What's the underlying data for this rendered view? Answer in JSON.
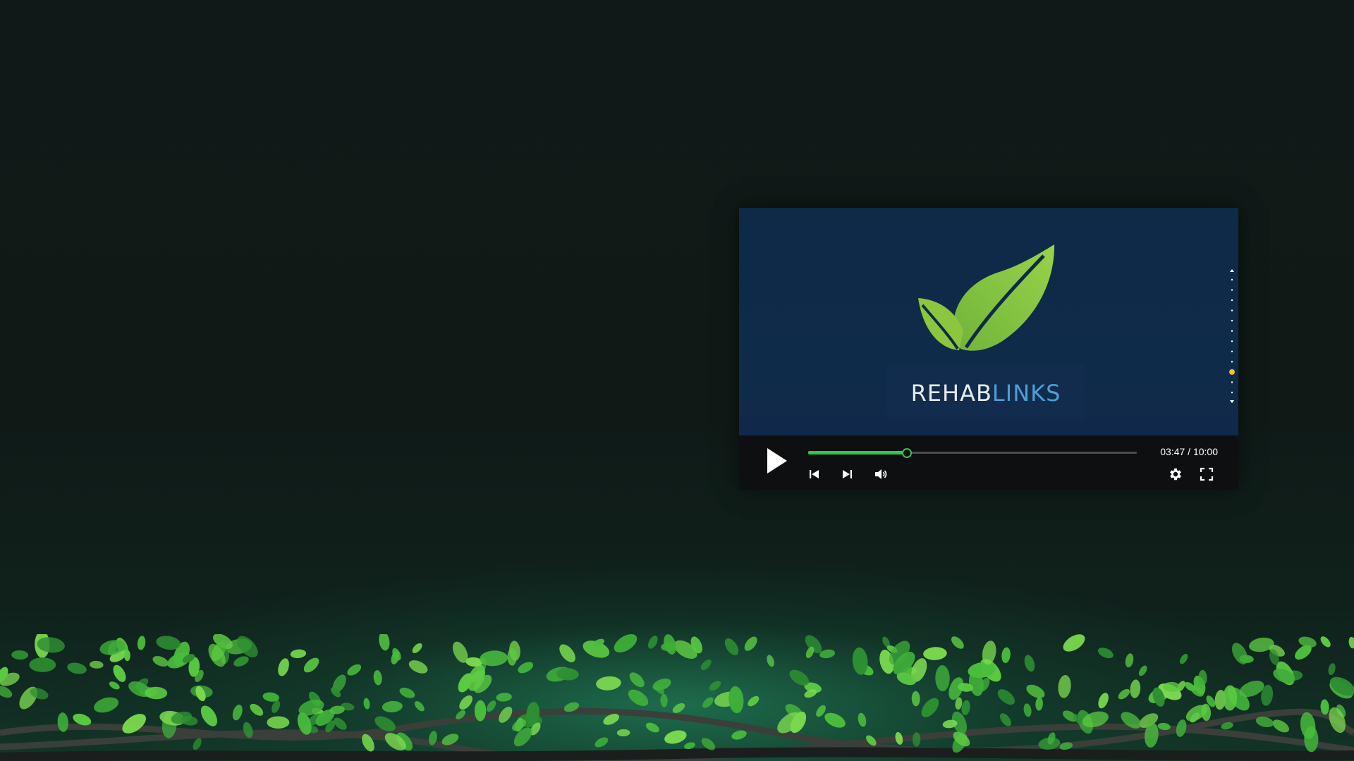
{
  "player": {
    "logo": {
      "text_part1": "REHAB",
      "text_part2": "LINKS",
      "colors": {
        "leaf": "#8ccb3e",
        "text_part1": "#e6ebf0",
        "text_part2": "#4d9fd4"
      }
    },
    "time": {
      "current": "03:47",
      "separator": " / ",
      "total": "10:00",
      "display": "03:47 / 10:00"
    },
    "progress_fraction": 0.3,
    "chapters": {
      "count": 12,
      "active_index": 9,
      "active_color": "#f2c230"
    },
    "colors": {
      "accent": "#35c44a",
      "control_bar": "#0e0f10",
      "video_bg": "#0f2a47"
    },
    "icons": {
      "play": "play-icon",
      "previous": "skip-previous-icon",
      "next": "skip-next-icon",
      "volume": "volume-icon",
      "settings": "gear-icon",
      "fullscreen": "fullscreen-icon"
    }
  }
}
